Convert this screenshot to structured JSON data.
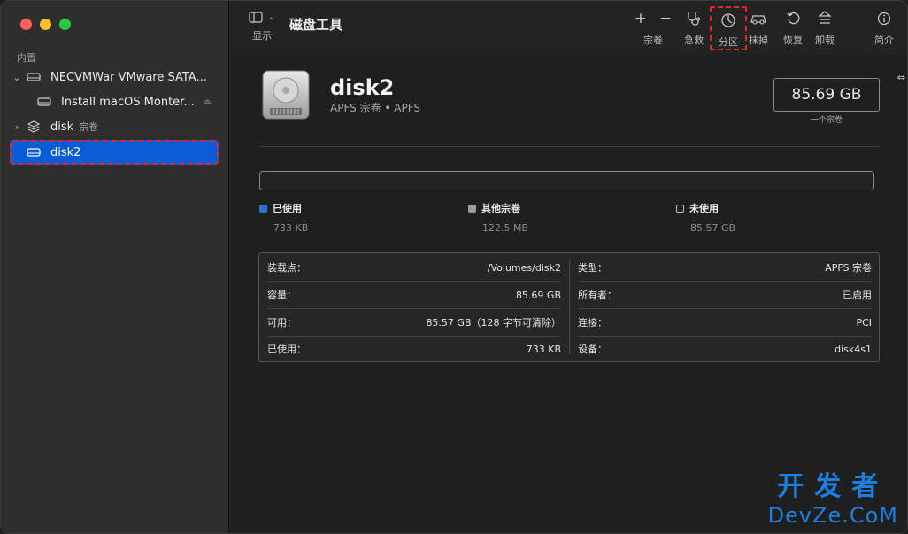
{
  "sidebar": {
    "section": "内置",
    "items": [
      {
        "label": "NECVMWar VMware SATA...",
        "expander": "⌄"
      },
      {
        "label": "Install macOS Monter..."
      },
      {
        "label": "disk",
        "sub": "宗卷",
        "expander": "›"
      },
      {
        "label": "disk2"
      }
    ]
  },
  "toolbar": {
    "title": "磁盘工具",
    "display_label": "显示",
    "buttons": [
      {
        "label": "宗卷"
      },
      {
        "label": "急救"
      },
      {
        "label": "分区"
      },
      {
        "label": "抹掉"
      },
      {
        "label": "恢复"
      },
      {
        "label": "卸载"
      },
      {
        "label": "简介"
      }
    ]
  },
  "disk": {
    "name": "disk2",
    "subtitle": "APFS 宗卷 • APFS",
    "capacity": "85.69 GB",
    "capacity_label": "一个宗卷"
  },
  "usage": {
    "used_fraction": 0.0001,
    "legend": [
      {
        "label": "已使用",
        "value": "733 KB",
        "color": "#2b72c9"
      },
      {
        "label": "其他宗卷",
        "value": "122.5 MB",
        "color": "#9a9a9a"
      },
      {
        "label": "未使用",
        "value": "85.57 GB",
        "color": "#232323"
      }
    ]
  },
  "info": {
    "left": [
      {
        "label": "装载点：",
        "value": "/Volumes/disk2"
      },
      {
        "label": "容量：",
        "value": "85.69 GB"
      },
      {
        "label": "可用：",
        "value": "85.57 GB（128 字节可清除）"
      },
      {
        "label": "已使用：",
        "value": "733 KB"
      }
    ],
    "right": [
      {
        "label": "类型：",
        "value": "APFS 宗卷"
      },
      {
        "label": "所有者：",
        "value": "已启用"
      },
      {
        "label": "连接：",
        "value": "PCI"
      },
      {
        "label": "设备：",
        "value": "disk4s1"
      }
    ]
  },
  "watermark": {
    "top": "开发者",
    "bottom": "DevZe.CoM"
  }
}
